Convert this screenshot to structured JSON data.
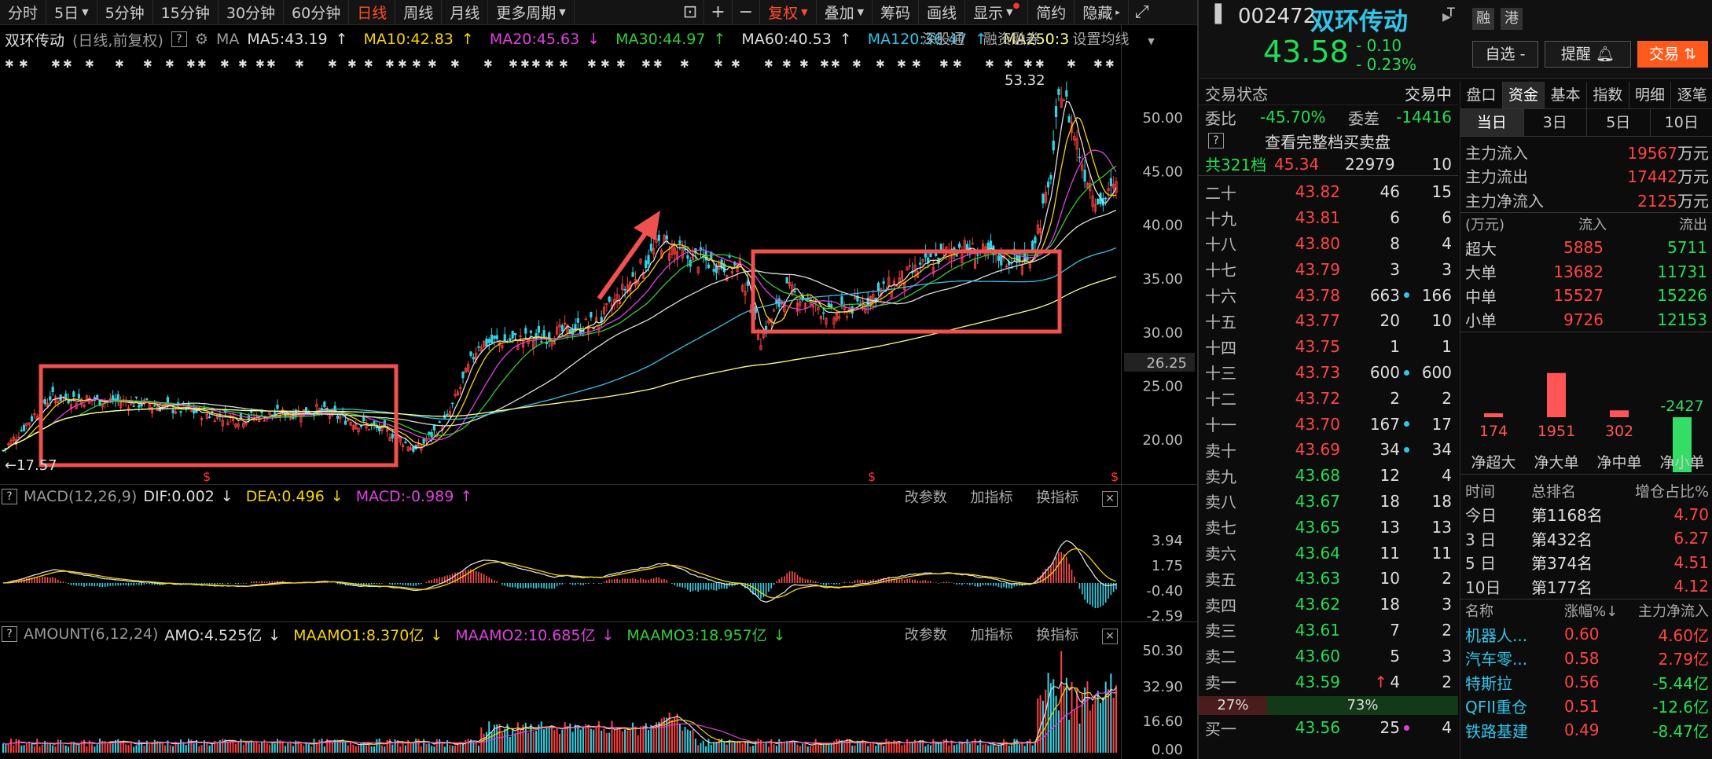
{
  "toolbar": {
    "periods": [
      "分时",
      "5日",
      "5分钟",
      "15分钟",
      "30分钟",
      "60分钟",
      "日线",
      "周线",
      "月线",
      "更多周期"
    ],
    "active": "日线",
    "fuquan": "复权",
    "diejia": "叠加",
    "chouma": "筹码",
    "huaxian": "画线",
    "xianshi": "显示",
    "jianyue": "简约",
    "yincang": "隐藏"
  },
  "main_chart": {
    "name": "双环传动",
    "mode": "(日线,前复权)",
    "ma_label": "MA",
    "ma": [
      {
        "label": "MA5:43.19",
        "arrow": "↑",
        "color": "#dddddd"
      },
      {
        "label": "MA10:42.83",
        "arrow": "↑",
        "color": "#f5d400"
      },
      {
        "label": "MA20:45.63",
        "arrow": "↓",
        "color": "#e040e0"
      },
      {
        "label": "MA30:44.97",
        "arrow": "↑",
        "color": "#33cc33"
      },
      {
        "label": "MA60:40.53",
        "arrow": "↑",
        "color": "#dddddd"
      },
      {
        "label": "MA120:36.47",
        "arrow": "↑",
        "color": "#33c4e8"
      },
      {
        "label": "MA250:3",
        "arrow": "",
        "color": "#ffff88"
      }
    ],
    "menus": [
      "深股通",
      "融资融券",
      "设置均线"
    ],
    "y_ticks": [
      "50.00",
      "45.00",
      "40.00",
      "35.00",
      "30.00",
      "25.00",
      "20.00"
    ],
    "current_price_tag": "26.25",
    "high_label": "53.32",
    "low_label": "17.57"
  },
  "macd": {
    "title": "MACD(12,26,9)",
    "dif": "DIF:0.002",
    "dif_arrow": "↓",
    "dea": "DEA:0.496",
    "dea_arrow": "↓",
    "macd": "MACD:-0.989",
    "macd_arrow": "↑",
    "y_ticks": [
      "3.94",
      "1.75",
      "-0.40",
      "-2.59"
    ]
  },
  "amount": {
    "title": "AMOUNT(6,12,24)",
    "amo": "AMO:4.525亿",
    "amo_arrow": "↓",
    "m1": "MAAMO1:8.370亿",
    "m1_arrow": "↓",
    "m2": "MAAMO2:10.685亿",
    "m2_arrow": "↓",
    "m3": "MAAMO3:18.957亿",
    "m3_arrow": "↓",
    "y_ticks": [
      "50.30",
      "32.90",
      "16.60",
      "0.00"
    ]
  },
  "sub_tools": [
    "改参数",
    "加指标",
    "换指标"
  ],
  "header": {
    "code": "002472",
    "name": "双环传动",
    "tag_t": "T",
    "badge1": "融",
    "badge2": "港",
    "price": "43.58",
    "change": "- 0.10",
    "change_pct": "- 0.23%",
    "btn_zixuan": "自选 -",
    "btn_tixing": "提醒",
    "btn_jiaoyi": "交易"
  },
  "orderbook": {
    "status_label": "交易状态",
    "status_value": "交易中",
    "weibi_label": "委比",
    "weibi_value": "-45.70%",
    "weicha_label": "委差",
    "weicha_value": "-14416",
    "full_book": "查看完整档买卖盘",
    "total_label": "共321档",
    "total_price": "45.34",
    "total_vol": "22979",
    "total_chg": "10",
    "rows": [
      {
        "lbl": "二十",
        "pr": "43.82",
        "vol": "46",
        "dot": "",
        "chg": "15",
        "side": "up"
      },
      {
        "lbl": "十九",
        "pr": "43.81",
        "vol": "6",
        "dot": "",
        "chg": "6",
        "side": "up"
      },
      {
        "lbl": "十八",
        "pr": "43.80",
        "vol": "8",
        "dot": "",
        "chg": "4",
        "side": "up"
      },
      {
        "lbl": "十七",
        "pr": "43.79",
        "vol": "3",
        "dot": "",
        "chg": "3",
        "side": "up"
      },
      {
        "lbl": "十六",
        "pr": "43.78",
        "vol": "663",
        "dot": "#33c4e8",
        "chg": "166",
        "side": "up"
      },
      {
        "lbl": "十五",
        "pr": "43.77",
        "vol": "20",
        "dot": "",
        "chg": "10",
        "side": "up"
      },
      {
        "lbl": "十四",
        "pr": "43.75",
        "vol": "1",
        "dot": "",
        "chg": "1",
        "side": "up"
      },
      {
        "lbl": "十三",
        "pr": "43.73",
        "vol": "600",
        "dot": "#33c4e8",
        "chg": "600",
        "side": "up"
      },
      {
        "lbl": "十二",
        "pr": "43.72",
        "vol": "2",
        "dot": "",
        "chg": "2",
        "side": "up"
      },
      {
        "lbl": "十一",
        "pr": "43.70",
        "vol": "167",
        "dot": "#33c4e8",
        "chg": "17",
        "side": "up"
      },
      {
        "lbl": "卖十",
        "pr": "43.69",
        "vol": "34",
        "dot": "#33c4e8",
        "chg": "34",
        "side": "up"
      },
      {
        "lbl": "卖九",
        "pr": "43.68",
        "vol": "12",
        "dot": "",
        "chg": "4",
        "side": "dn"
      },
      {
        "lbl": "卖八",
        "pr": "43.67",
        "vol": "18",
        "dot": "",
        "chg": "18",
        "side": "dn"
      },
      {
        "lbl": "卖七",
        "pr": "43.65",
        "vol": "13",
        "dot": "",
        "chg": "13",
        "side": "dn"
      },
      {
        "lbl": "卖六",
        "pr": "43.64",
        "vol": "11",
        "dot": "",
        "chg": "11",
        "side": "dn"
      },
      {
        "lbl": "卖五",
        "pr": "43.63",
        "vol": "10",
        "dot": "",
        "chg": "2",
        "side": "dn"
      },
      {
        "lbl": "卖四",
        "pr": "43.62",
        "vol": "18",
        "dot": "",
        "chg": "3",
        "side": "dn"
      },
      {
        "lbl": "卖三",
        "pr": "43.61",
        "vol": "7",
        "dot": "",
        "chg": "2",
        "side": "dn"
      },
      {
        "lbl": "卖二",
        "pr": "43.60",
        "vol": "5",
        "dot": "",
        "chg": "3",
        "side": "dn"
      },
      {
        "lbl": "卖一",
        "pr": "43.59",
        "vol": "4",
        "dot": "",
        "chg": "2",
        "side": "dn",
        "mark": "↑"
      }
    ],
    "ratio_left": "27%",
    "ratio_right": "73%",
    "buy1": {
      "lbl": "买一",
      "pr": "43.56",
      "vol": "25",
      "chg": "4"
    }
  },
  "fundflow": {
    "tabs": [
      "盘口",
      "资金",
      "基本",
      "指数",
      "明细",
      "逐笔"
    ],
    "active_tab": "资金",
    "period_tabs": [
      "当日",
      "3日",
      "5日",
      "10日"
    ],
    "active_period": "当日",
    "summary": [
      {
        "label": "主力流入",
        "value": "19567",
        "unit": "万元"
      },
      {
        "label": "主力流出",
        "value": "17442",
        "unit": "万元"
      },
      {
        "label": "主力净流入",
        "value": "2125",
        "unit": "万元"
      }
    ],
    "table_head": [
      "(万元)",
      "流入",
      "流出"
    ],
    "table": [
      {
        "label": "超大",
        "in": "5885",
        "out": "5711"
      },
      {
        "label": "大单",
        "in": "13682",
        "out": "11731"
      },
      {
        "label": "中单",
        "in": "15527",
        "out": "15226"
      },
      {
        "label": "小单",
        "in": "9726",
        "out": "12153"
      }
    ],
    "net_bars": [
      {
        "label": "净超大",
        "value": 174
      },
      {
        "label": "净大单",
        "value": 1951
      },
      {
        "label": "净中单",
        "value": 302
      },
      {
        "label": "净小单",
        "value": -2427
      }
    ],
    "rank_head": [
      "时间",
      "总排名",
      "增仓占比%"
    ],
    "rank": [
      {
        "t": "今日",
        "r": "第1168名",
        "p": "4.70"
      },
      {
        "t": "3 日",
        "r": "第432名",
        "p": "6.27"
      },
      {
        "t": "5 日",
        "r": "第374名",
        "p": "4.51"
      },
      {
        "t": "10日",
        "r": "第177名",
        "p": "4.12"
      }
    ],
    "sector_head": [
      "名称",
      "涨幅%↓",
      "主力净流入"
    ],
    "sectors": [
      {
        "n": "机器人...",
        "p": "0.60",
        "f": "4.60亿"
      },
      {
        "n": "汽车零...",
        "p": "0.58",
        "f": "2.79亿"
      },
      {
        "n": "特斯拉",
        "p": "0.56",
        "f": "-5.44亿"
      },
      {
        "n": "QFII重仓",
        "p": "0.51",
        "f": "-12.6亿"
      },
      {
        "n": "铁路基建",
        "p": "0.49",
        "f": "-8.47亿"
      }
    ]
  }
}
